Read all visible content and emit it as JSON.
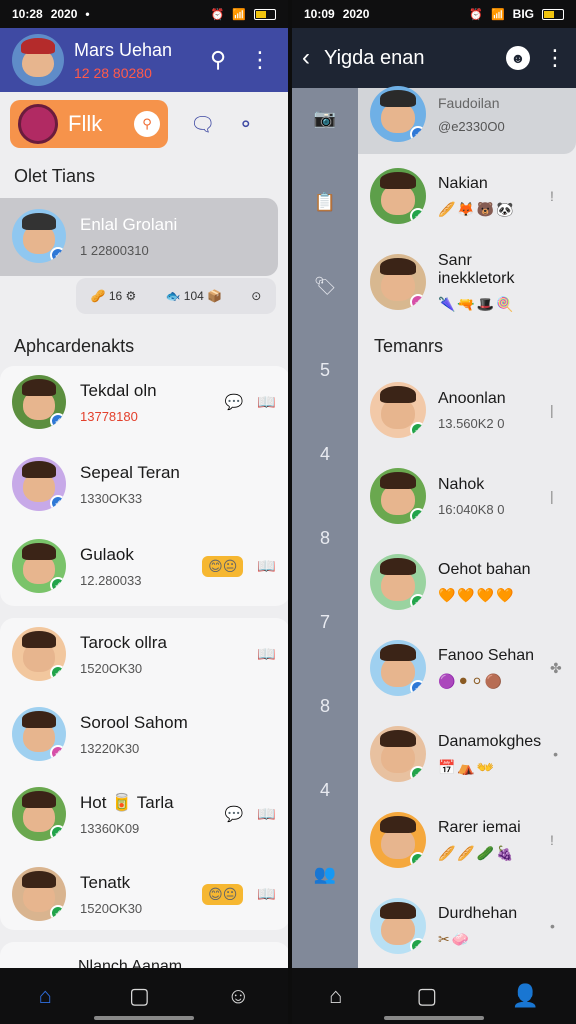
{
  "left": {
    "status": {
      "time": "10:28",
      "extra": "2020",
      "signal": "•"
    },
    "header": {
      "title": "Mars Uehan",
      "subtitle": "12 28 80280",
      "search_icon": "search-icon",
      "more_icon": "more-icon"
    },
    "filter": {
      "label": "Fllk"
    },
    "section1": "Olet Tians",
    "highlight": {
      "name": "Enlal Grolani",
      "sub": "1 22800310",
      "chips": [
        "🥜 16 ⚙",
        "🐟 104 📦",
        "⊙"
      ]
    },
    "section2": "Aphcardenakts",
    "rows1": [
      {
        "name": "Tekdal oln",
        "sub": "13778180",
        "subRed": true,
        "act": [
          "💬",
          "📖"
        ]
      },
      {
        "name": "Sepeal Teran",
        "sub": "1330OK33",
        "act": []
      },
      {
        "name": "Gulaok",
        "sub": "12.280033",
        "emo": "😊😐",
        "act": [
          "📖"
        ]
      }
    ],
    "rows2": [
      {
        "name": "Tarock ollra",
        "sub": "1520OK30",
        "act": [
          "📖"
        ]
      },
      {
        "name": "Sorool Sahom",
        "sub": "13220K30",
        "act": []
      },
      {
        "name": "Hot 🥫 Tarla",
        "sub": "13360K09",
        "act": [
          "💬",
          "📖"
        ]
      },
      {
        "name": "Tenatk",
        "sub": "1520OK30",
        "emo": "😊😐",
        "act": [
          "📖"
        ]
      }
    ],
    "peek": "Nlanch Aanam"
  },
  "right": {
    "status": {
      "time": "10:09",
      "extra": "2020",
      "net": "BIG"
    },
    "header": {
      "title": "Yigda enan"
    },
    "rail": [
      "📷",
      "📋",
      "🏷",
      "5",
      "4",
      "8",
      "7",
      "8",
      "4",
      "👥"
    ],
    "top": {
      "name": "Faudoilan",
      "sub": "@e2330O0"
    },
    "rows1": [
      {
        "name": "Nakian",
        "icons": "🥖🦊🐻🐼",
        "end": "!"
      },
      {
        "name": "Sanr inekkletork",
        "icons": "🌂🔫🎩🍭",
        "end": ""
      }
    ],
    "section": "Temanrs",
    "rows2": [
      {
        "name": "Anoonlan",
        "sub": "13.560K2 0",
        "end": "|"
      },
      {
        "name": "Nahok",
        "sub": "16:040K8 0",
        "end": "|"
      },
      {
        "name": "Oehot bahan",
        "icons": "🧡🧡🧡🧡",
        "end": ""
      },
      {
        "name": "Fanoo Sehan",
        "icons": "🟣⚫⚪🟤",
        "end": "✤"
      },
      {
        "name": "Danamokghes",
        "icons": "📅⛺👐",
        "end": "•"
      },
      {
        "name": "Rarer iemai",
        "icons": "🥖🥖🥒🍇",
        "end": "!"
      },
      {
        "name": "Durdhehan",
        "icons": "✂🧼",
        "end": "•"
      }
    ]
  }
}
